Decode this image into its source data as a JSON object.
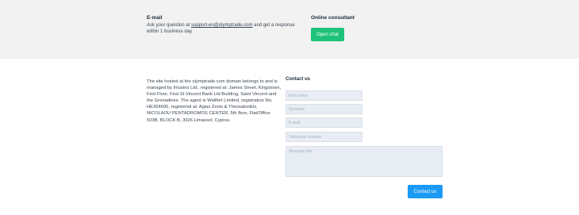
{
  "email_section": {
    "title": "E-mail",
    "text_before_link": "Ask your question at ",
    "link": "support-en@olymptrade.com",
    "text_after_link": " and get a response within 1 business day"
  },
  "consultant_section": {
    "title": "Online consultant",
    "button_label": "Open chat"
  },
  "legal_text": "The site hosted at the olymptrade.com domain belongs to and is managed by Inlustris Ltd., registered at: James Street, Kingstown, First Floor, First St Vincent Bank Ltd Building, Saint Vincent and the Grenadines. The agent is Wallfort Limited, registration No. HE364695, registered at: Agias Zonis & Thessalonikis, NICOLAOU PENTADROMOS CENTER, 5th floor, Flat/Office 503B, BLOCK B, 3026 Limassol, Cyprus.",
  "contact_form": {
    "title": "Contact us",
    "first_name_placeholder": "First name",
    "surname_placeholder": "Surname",
    "email_placeholder": "E-mail",
    "phone_placeholder": "Telephone number",
    "message_placeholder": "Message text",
    "submit_label": "Contact us"
  },
  "colors": {
    "chat_button": "#1fc27a",
    "contact_button": "#1a9af5",
    "top_band": "#f2f2f2",
    "field_background": "#e8edf3"
  }
}
